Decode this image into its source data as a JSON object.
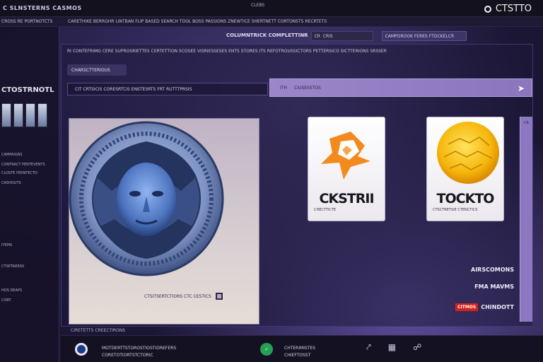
{
  "topbar": {
    "app_title": "C SLNSTERNS  CASMOS",
    "center_label": "CLEBS",
    "brand": "CTSTTO"
  },
  "menubar": {
    "left_text": "CROSS RE PORTNOTCTS",
    "mid_text": "CARETHIKE BERRGHR LINTBAN FLIP BASED SEARCH TOOL BOSS  PASSIONS  ZNEWTICE SHERTNETT  CORTONSTS  RECRTETS"
  },
  "search": {
    "label": "COLUMNTRICK COMPLETTINR",
    "input_value": "CR  CRIS",
    "pill_text": "CAMPOROOK FERES FTOCKELCR"
  },
  "sidebar": {
    "title": "CTOSTRNOTL",
    "items": [
      "CAMPAIGNS",
      "CONTRACT PENTEVENTS",
      "CLOSTE FERNTECTO",
      "CASHOUTS",
      "ITEMS",
      "CTSETAREAS",
      "HOS DEAPS",
      "CORT"
    ]
  },
  "main": {
    "tabstrip": "RI  CONTEFRIMG CERE SUPROSRIETTES  CERTETTION SCOSEE VISRIESSESES  ENTS  STORES  ITS  REFOTROUSSICTORS PETTERSICO SICTTERIONS SRSSER",
    "section_chip": "CHARSCTTERIOUS",
    "crumb": "CIT  CRTSICIS  CORESRTCIS  ENSTESRTS  FRT  RUTTTPRSIS",
    "purple_bar": {
      "number": "ITH",
      "text": "CIUSESSTOS"
    },
    "hero_caption": "CTSITSERTCTIORS  CTC  CESTICS",
    "cards": [
      {
        "name": "CKSTRII",
        "sub": "CHECTTICTE"
      },
      {
        "name": "TOCKTO",
        "sub": "CTSCTRETSIE CTENCTICS"
      }
    ],
    "rail_label": "CR",
    "stats": [
      {
        "text": "AIRSCOMONS"
      },
      {
        "text": "FMA MAVMS"
      },
      {
        "badge": "CITMOS",
        "text": "CHINDOTT"
      }
    ]
  },
  "footer": {
    "label": "CIRETETTS CREECTIRONS",
    "item1_line1": "MOTDERTTSTOROSTIOSTIOREFERS",
    "item1_line2": "CORETOTIORTSTCTORIC",
    "item2_line1": "CHTERIMISTES",
    "item2_line2": "CHIEFTOSST"
  },
  "colors": {
    "accent_purple": "#9a86c8",
    "background": "#1b1634",
    "badge_red": "#d4221c",
    "green_button": "#24a054"
  }
}
